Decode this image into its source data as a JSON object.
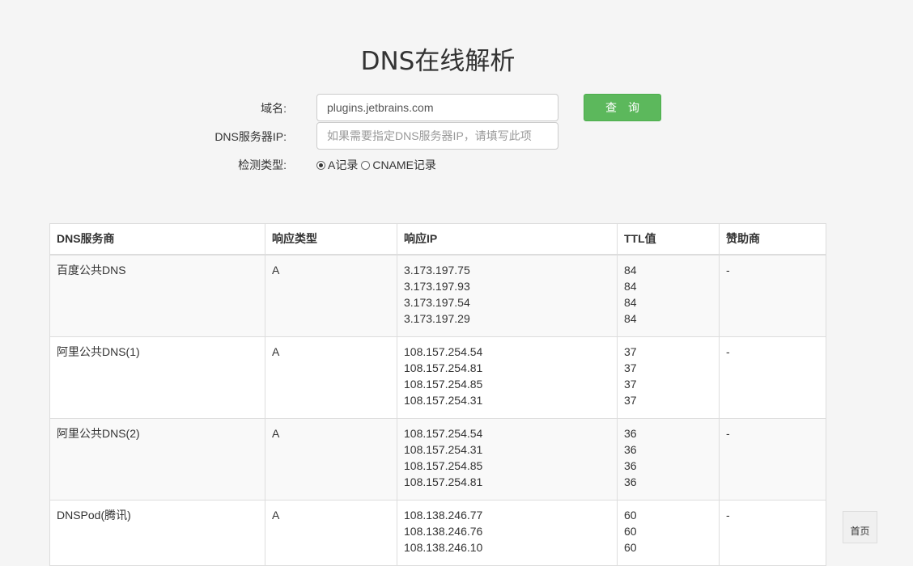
{
  "title": "DNS在线解析",
  "form": {
    "domain_label": "域名:",
    "domain_value": "plugins.jetbrains.com",
    "dns_server_label": "DNS服务器IP:",
    "dns_server_placeholder": "如果需要指定DNS服务器IP，请填写此项",
    "type_label": "检测类型:",
    "type_options": [
      "A记录",
      "CNAME记录"
    ],
    "type_selected": "A记录",
    "query_button": "查询"
  },
  "table": {
    "headers": [
      "DNS服务商",
      "响应类型",
      "响应IP",
      "TTL值",
      "赞助商"
    ],
    "rows": [
      {
        "provider": "百度公共DNS",
        "type": "A",
        "ips": [
          "3.173.197.75",
          "3.173.197.93",
          "3.173.197.54",
          "3.173.197.29"
        ],
        "ttls": [
          "84",
          "84",
          "84",
          "84"
        ],
        "sponsor": "-"
      },
      {
        "provider": "阿里公共DNS(1)",
        "type": "A",
        "ips": [
          "108.157.254.54",
          "108.157.254.81",
          "108.157.254.85",
          "108.157.254.31"
        ],
        "ttls": [
          "37",
          "37",
          "37",
          "37"
        ],
        "sponsor": "-"
      },
      {
        "provider": "阿里公共DNS(2)",
        "type": "A",
        "ips": [
          "108.157.254.54",
          "108.157.254.31",
          "108.157.254.85",
          "108.157.254.81"
        ],
        "ttls": [
          "36",
          "36",
          "36",
          "36"
        ],
        "sponsor": "-"
      },
      {
        "provider": "DNSPod(腾讯)",
        "type": "A",
        "ips": [
          "108.138.246.77",
          "108.138.246.76",
          "108.138.246.10"
        ],
        "ttls": [
          "60",
          "60",
          "60"
        ],
        "sponsor": "-"
      }
    ]
  },
  "home_button": "首页"
}
